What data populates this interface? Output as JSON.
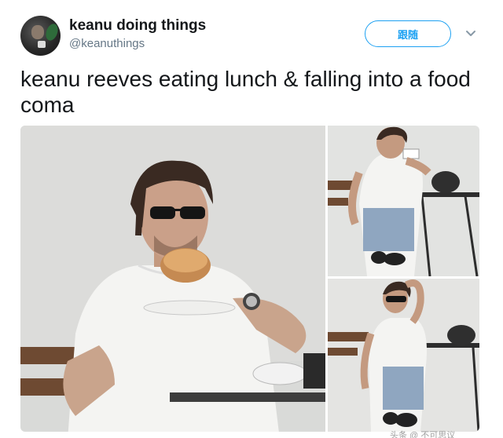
{
  "tweet": {
    "display_name": "keanu doing things",
    "handle": "@keanuthings",
    "follow_label": "跟随",
    "text": "keanu reeves eating lunch & falling into a food coma",
    "media_icons": [
      "avatar-photo",
      "photo-eating-sandwich",
      "photo-drinking",
      "photo-food-coma"
    ]
  },
  "watermark": {
    "text": "头条 @ 不可思议"
  },
  "colors": {
    "accent": "#1da1f2",
    "text_primary": "#14171a",
    "text_secondary": "#657786"
  }
}
